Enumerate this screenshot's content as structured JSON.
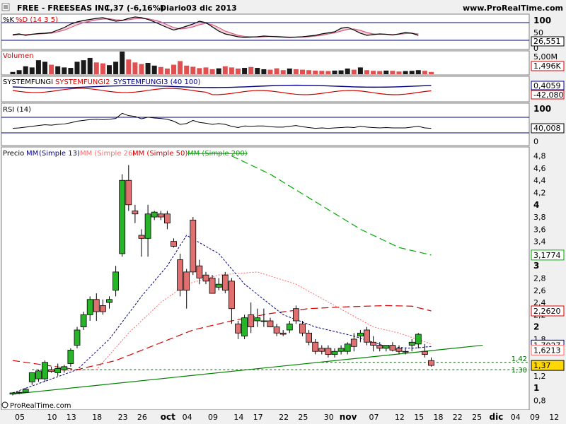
{
  "header": {
    "ticker": "FREE - FREESEAS INC.",
    "quote": "1,37 (-6,16%)",
    "period": "Diario",
    "date": "03 dic 2013",
    "site": "www.ProRealTime.com"
  },
  "footer": {
    "copyright": "© ProRealTime.com"
  },
  "colors": {
    "bull": "#28b428",
    "bear": "#e07070",
    "sma13": "#000080",
    "sma26": "#ff6a6a",
    "sma50": "#d40000",
    "sma200": "#00aa00",
    "trendline": "#008000",
    "panel_line": "#000080"
  },
  "panels": {
    "stoch": {
      "label_k": "%K",
      "label_d": "%D (14 3 5)",
      "ticks": [
        "100",
        "50",
        "0"
      ],
      "value": "26,551"
    },
    "volume": {
      "label": "Volumen",
      "ticks": [
        "5,00M",
        "2,50M",
        "0"
      ],
      "value": "1,496K"
    },
    "systemfungi": {
      "label1": "SYSTEMFUNGI",
      "label2": "SYSTEMFUNGI2",
      "label3": "SYSTEMFUNGI3 (40 100)",
      "values": [
        "0,4059",
        "-42,080"
      ]
    },
    "rsi": {
      "label": "RSI (14)",
      "ticks": [
        "100",
        "0"
      ],
      "value": "40,008"
    },
    "price": {
      "label_price": "Precio",
      "label_mm1": "MM",
      "label_mm1_param": "(Simple 13)",
      "label_mm2": "MM (Simple 26)",
      "label_mm3": "MM (Simple 50)",
      "label_mm4": "MM (Simple 200)"
    }
  },
  "chart_data": {
    "type": "candlestick",
    "title": "FREE - FREESEAS INC.",
    "period": "Diario",
    "last_price": 1.37,
    "change_pct": -6.16,
    "ylim": [
      0.7,
      4.9
    ],
    "y_ticks": [
      0.8,
      1,
      1.2,
      1.4,
      1.6,
      1.8,
      2,
      2.2,
      2.4,
      2.6,
      2.8,
      3,
      3.2,
      3.4,
      3.6,
      3.8,
      4,
      4.2,
      4.4,
      4.6,
      4.8
    ],
    "y_tick_labels": [
      "0,8",
      "1",
      "1,2",
      "1,4",
      "1,6",
      "1,8",
      "2",
      "2,2",
      "2,4",
      "2,6",
      "2,8",
      "3",
      "3,2",
      "3,4",
      "3,6",
      "3,8",
      "4",
      "4,2",
      "4,4",
      "4,6",
      "4,8"
    ],
    "y_bold_ticks": [
      1,
      2,
      3,
      4
    ],
    "x_labels": [
      "05",
      "10",
      "13",
      "18",
      "23",
      "26",
      "oct",
      "04",
      "09",
      "14",
      "17",
      "22",
      "25",
      "30",
      "nov",
      "07",
      "12",
      "15",
      "18",
      "22",
      "25",
      "dic",
      "04",
      "09",
      "12"
    ],
    "x_bold_labels": [
      "oct",
      "nov",
      "dic"
    ],
    "ohlc": [
      [
        0.9,
        0.93,
        0.88,
        0.92
      ],
      [
        0.92,
        0.95,
        0.9,
        0.93
      ],
      [
        0.93,
        1.0,
        0.92,
        0.98
      ],
      [
        1.1,
        1.2,
        1.05,
        1.25
      ],
      [
        1.15,
        1.3,
        1.1,
        1.28
      ],
      [
        1.15,
        1.45,
        1.1,
        1.42
      ],
      [
        1.3,
        1.35,
        1.25,
        1.27
      ],
      [
        1.25,
        1.4,
        1.2,
        1.32
      ],
      [
        1.3,
        1.38,
        1.25,
        1.35
      ],
      [
        1.4,
        1.65,
        1.35,
        1.62
      ],
      [
        1.7,
        2.0,
        1.65,
        1.95
      ],
      [
        2.0,
        2.25,
        1.95,
        2.2
      ],
      [
        2.2,
        2.5,
        2.1,
        2.45
      ],
      [
        2.45,
        2.55,
        2.1,
        2.25
      ],
      [
        2.35,
        2.45,
        2.2,
        2.25
      ],
      [
        2.4,
        2.5,
        2.3,
        2.45
      ],
      [
        2.6,
        3.0,
        2.5,
        2.9
      ],
      [
        3.2,
        4.5,
        3.15,
        4.4
      ],
      [
        4.4,
        4.65,
        3.9,
        4.0
      ],
      [
        3.9,
        4.0,
        3.7,
        3.85
      ],
      [
        3.5,
        3.6,
        3.15,
        3.45
      ],
      [
        3.45,
        4.0,
        3.15,
        3.85
      ],
      [
        3.8,
        3.9,
        3.75,
        3.88
      ],
      [
        3.85,
        3.9,
        3.75,
        3.8
      ],
      [
        3.85,
        3.9,
        3.6,
        3.7
      ],
      [
        3.4,
        3.45,
        3.3,
        3.32
      ],
      [
        3.1,
        3.2,
        2.5,
        2.6
      ],
      [
        2.9,
        2.95,
        2.3,
        2.6
      ],
      [
        3.75,
        3.8,
        2.85,
        2.9
      ],
      [
        3.0,
        3.1,
        2.7,
        2.8
      ],
      [
        2.85,
        2.9,
        2.7,
        2.75
      ],
      [
        2.8,
        2.85,
        2.55,
        2.55
      ],
      [
        2.65,
        2.8,
        2.6,
        2.7
      ],
      [
        2.85,
        2.9,
        2.55,
        2.6
      ],
      [
        2.75,
        2.8,
        2.05,
        2.3
      ],
      [
        2.05,
        2.1,
        1.8,
        1.9
      ],
      [
        1.85,
        2.2,
        1.8,
        2.15
      ],
      [
        2.2,
        2.4,
        1.9,
        2.0
      ],
      [
        2.1,
        2.3,
        2.0,
        2.15
      ],
      [
        2.1,
        2.3,
        2.0,
        2.1
      ],
      [
        2.1,
        2.15,
        2.0,
        2.0
      ],
      [
        2.0,
        2.05,
        1.85,
        1.9
      ],
      [
        1.9,
        1.95,
        1.85,
        1.88
      ],
      [
        1.95,
        2.1,
        1.9,
        2.05
      ],
      [
        2.3,
        2.35,
        2.05,
        2.1
      ],
      [
        2.05,
        2.1,
        1.85,
        1.9
      ],
      [
        1.9,
        1.95,
        1.7,
        1.75
      ],
      [
        1.75,
        1.8,
        1.55,
        1.6
      ],
      [
        1.65,
        1.7,
        1.55,
        1.6
      ],
      [
        1.65,
        1.7,
        1.5,
        1.55
      ],
      [
        1.55,
        1.65,
        1.5,
        1.6
      ],
      [
        1.6,
        1.7,
        1.55,
        1.65
      ],
      [
        1.6,
        1.75,
        1.55,
        1.72
      ],
      [
        1.8,
        1.9,
        1.6,
        1.68
      ],
      [
        1.85,
        1.95,
        1.75,
        1.9
      ],
      [
        1.95,
        2.0,
        1.7,
        1.75
      ],
      [
        1.75,
        1.85,
        1.6,
        1.7
      ],
      [
        1.7,
        1.75,
        1.6,
        1.65
      ],
      [
        1.65,
        1.7,
        1.6,
        1.7
      ],
      [
        1.7,
        1.75,
        1.6,
        1.62
      ],
      [
        1.65,
        1.7,
        1.55,
        1.6
      ],
      [
        1.6,
        1.65,
        1.55,
        1.6
      ],
      [
        1.7,
        1.8,
        1.6,
        1.75
      ],
      [
        1.72,
        1.9,
        1.65,
        1.88
      ],
      [
        1.6,
        1.72,
        1.5,
        1.55
      ],
      [
        1.45,
        1.5,
        1.35,
        1.37
      ]
    ],
    "x_label_index": [
      0,
      5,
      8,
      12,
      16,
      19,
      23,
      26,
      30,
      34,
      37,
      41,
      44,
      48,
      51,
      55,
      59,
      62,
      65,
      68,
      71,
      74,
      77,
      80,
      83
    ],
    "sma13": [
      [
        0,
        0.92
      ],
      [
        10,
        1.3
      ],
      [
        15,
        1.8
      ],
      [
        20,
        2.5
      ],
      [
        24,
        3.0
      ],
      [
        27,
        3.5
      ],
      [
        32,
        3.2
      ],
      [
        36,
        2.7
      ],
      [
        42,
        2.2
      ],
      [
        47,
        2.0
      ],
      [
        53,
        1.85
      ],
      [
        58,
        1.68
      ],
      [
        62,
        1.65
      ],
      [
        65,
        1.68
      ]
    ],
    "sma26": [
      [
        5,
        1.28
      ],
      [
        13,
        1.3
      ],
      [
        18,
        1.9
      ],
      [
        23,
        2.4
      ],
      [
        27,
        2.7
      ],
      [
        32,
        2.85
      ],
      [
        38,
        2.9
      ],
      [
        44,
        2.7
      ],
      [
        50,
        2.35
      ],
      [
        56,
        2.0
      ],
      [
        60,
        1.9
      ],
      [
        65,
        1.72
      ]
    ],
    "sma50": [
      [
        0,
        1.45
      ],
      [
        10,
        1.3
      ],
      [
        16,
        1.45
      ],
      [
        22,
        1.7
      ],
      [
        28,
        1.95
      ],
      [
        34,
        2.1
      ],
      [
        40,
        2.22
      ],
      [
        46,
        2.3
      ],
      [
        52,
        2.33
      ],
      [
        58,
        2.35
      ],
      [
        62,
        2.34
      ],
      [
        65,
        2.262
      ]
    ],
    "sma200": [
      [
        34,
        4.8
      ],
      [
        40,
        4.5
      ],
      [
        47,
        4.05
      ],
      [
        54,
        3.6
      ],
      [
        60,
        3.3
      ],
      [
        65,
        3.1774
      ]
    ],
    "support_lines": [
      1.42,
      1.3
    ],
    "trendline": [
      [
        0,
        0.9
      ],
      [
        73,
        1.7
      ]
    ],
    "value_tags": [
      {
        "label": "3,1774",
        "value": 3.1774,
        "color": "#00aa00"
      },
      {
        "label": "2,2620",
        "value": 2.262,
        "color": "#d40000"
      },
      {
        "label": "1,7027",
        "value": 1.7027,
        "color": "#000080"
      },
      {
        "label": "1,6213",
        "value": 1.6213,
        "color": "#ff6a6a"
      },
      {
        "label": "1,37",
        "value": 1.37,
        "color": "#000000"
      }
    ],
    "support_labels": [
      "1,42",
      "1,30"
    ]
  }
}
